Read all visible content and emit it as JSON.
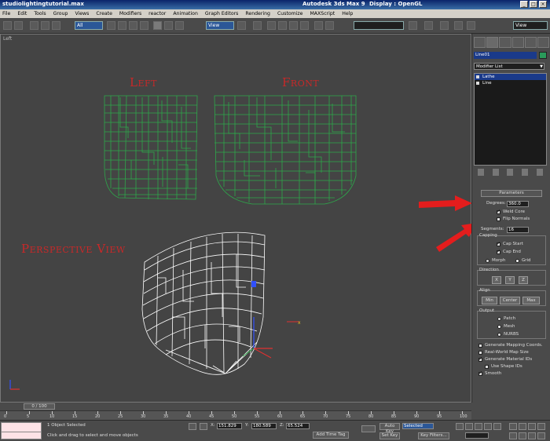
{
  "window": {
    "filename": "studiolightingtutorial.max",
    "app_title": "Autodesk 3ds Max 9",
    "display": "Display : OpenGL"
  },
  "menu": [
    "File",
    "Edit",
    "Tools",
    "Group",
    "Views",
    "Create",
    "Modifiers",
    "reactor",
    "Animation",
    "Graph Editors",
    "Rendering",
    "Customize",
    "MAXScript",
    "Help"
  ],
  "toolbar": {
    "selection_filter": "All",
    "ref_coord": "View",
    "selection_set": "",
    "view_dropdown": "View"
  },
  "viewport": {
    "label": "Left",
    "annotations": {
      "left": "Left",
      "front": "Front",
      "perspective": "Perspective View"
    }
  },
  "command_panel": {
    "object_name": "Line01",
    "modifier_list": "Modifier List",
    "stack": [
      "Lathe",
      "Line"
    ],
    "parameters": {
      "title": "Parameters",
      "degrees_label": "Degrees:",
      "degrees_value": "360.0",
      "weld_core": "Weld Core",
      "flip_normals": "Flip Normals",
      "segments_label": "Segments:",
      "segments_value": "16",
      "capping_title": "Capping",
      "cap_start": "Cap Start",
      "cap_end": "Cap End",
      "morph": "Morph",
      "grid": "Grid",
      "direction_title": "Direction",
      "dir_x": "X",
      "dir_y": "Y",
      "dir_z": "Z",
      "align_title": "Align",
      "align_min": "Min",
      "align_center": "Center",
      "align_max": "Max",
      "output_title": "Output",
      "out_patch": "Patch",
      "out_mesh": "Mesh",
      "out_nurbs": "NURBS",
      "gen_mapping": "Generate Mapping Coords.",
      "real_world": "Real-World Map Size",
      "gen_mat_ids": "Generate Material IDs",
      "use_shape_ids": "Use Shape IDs",
      "smooth": "Smooth"
    }
  },
  "timeline": {
    "frame": "0 / 100",
    "ticks": [
      "0",
      "5",
      "10",
      "15",
      "20",
      "25",
      "30",
      "35",
      "40",
      "45",
      "50",
      "55",
      "60",
      "65",
      "70",
      "75",
      "80",
      "85",
      "90",
      "95",
      "100"
    ]
  },
  "status": {
    "selection": "1 Object Selected",
    "prompt": "Click and drag to select and move objects",
    "x_label": "X:",
    "x_value": "151.829",
    "y_label": "Y:",
    "y_value": "180.589",
    "z_label": "Z:",
    "z_value": "65.524",
    "add_time_tag": "Add Time Tag",
    "auto_key": "Auto Key",
    "selected_value": "Selected",
    "set_key": "Set Key",
    "key_filters": "Key Filters..."
  },
  "colors": {
    "annotation_red": "#c82828",
    "wire_green": "#2da84a",
    "wire_white": "#ffffff",
    "viewport_bg": "#444444"
  }
}
